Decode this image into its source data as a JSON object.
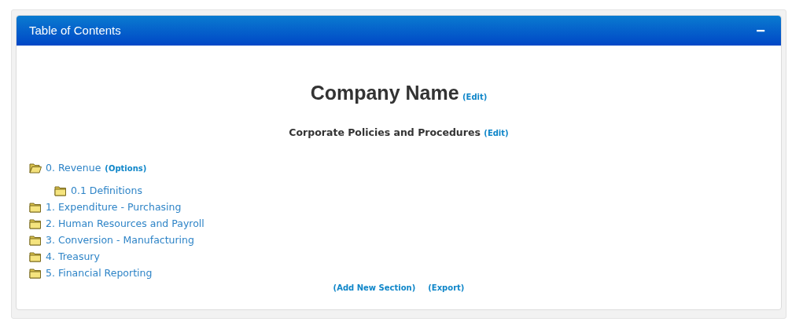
{
  "panel": {
    "title": "Table of Contents",
    "collapse_button": "−"
  },
  "company": {
    "name": "Company Name",
    "edit_link": "(Edit)"
  },
  "subtitle": {
    "text": "Corporate Policies and Procedures",
    "edit_link": "(Edit)"
  },
  "sections": [
    {
      "label": "0. Revenue",
      "options_link": "(Options)",
      "expanded": true,
      "children": [
        {
          "label": "0.1 Definitions",
          "expanded": false
        }
      ]
    },
    {
      "label": "1. Expenditure - Purchasing",
      "expanded": false
    },
    {
      "label": "2. Human Resources and Payroll",
      "expanded": false
    },
    {
      "label": "3. Conversion - Manufacturing",
      "expanded": false
    },
    {
      "label": "4. Treasury",
      "expanded": false
    },
    {
      "label": "5. Financial Reporting",
      "expanded": false
    }
  ],
  "footer_links": [
    "(Add New Section)",
    "(Export)"
  ]
}
